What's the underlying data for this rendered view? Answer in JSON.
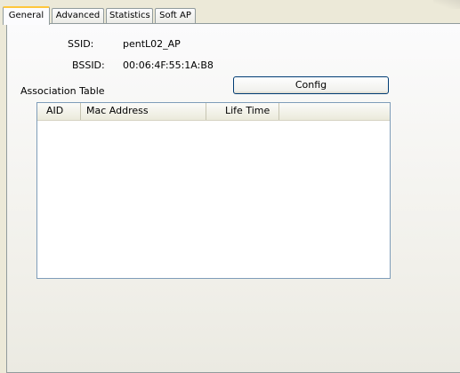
{
  "tabs": [
    "General",
    "Advanced",
    "Statistics",
    "Soft AP"
  ],
  "ssid": {
    "label": "SSID:",
    "value": "pentL02_AP"
  },
  "bssid": {
    "label": "BSSID:",
    "value": "00:06:4F:55:1A:B8"
  },
  "association_table": {
    "title": "Association Table",
    "columns": [
      "AID",
      "Mac Address",
      "Life Time"
    ],
    "rows": []
  },
  "config_button": "Config"
}
